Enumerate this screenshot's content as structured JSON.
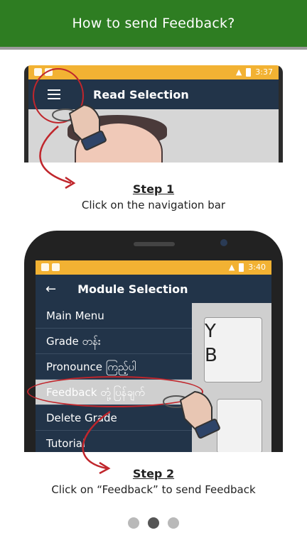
{
  "header": {
    "title": "How to send Feedback?"
  },
  "step1": {
    "title": "Step 1",
    "desc": "Click on the navigation bar",
    "time": "3:37",
    "appbar_title": "Read Selection"
  },
  "step2": {
    "title": "Step 2",
    "desc": "Click on “Feedback” to send Feedback",
    "time": "3:40",
    "appbar_title": "Module Selection",
    "menu": [
      {
        "label": "Main Menu"
      },
      {
        "label": "Grade တန်း"
      },
      {
        "label": "Pronounce ကြည့်ပါ"
      },
      {
        "label": "Feedback တုံ့ပြန်ချက်"
      },
      {
        "label": "Delete Grade"
      },
      {
        "label": "Tutorial"
      }
    ],
    "bg_letters": [
      "Y",
      "B"
    ]
  },
  "pager": {
    "count": 3,
    "active_index": 1
  },
  "colors": {
    "header_bg": "#2e7d22",
    "appbar_bg": "#223449",
    "status_bg": "#f2b233",
    "highlight_red": "#c0262c"
  }
}
